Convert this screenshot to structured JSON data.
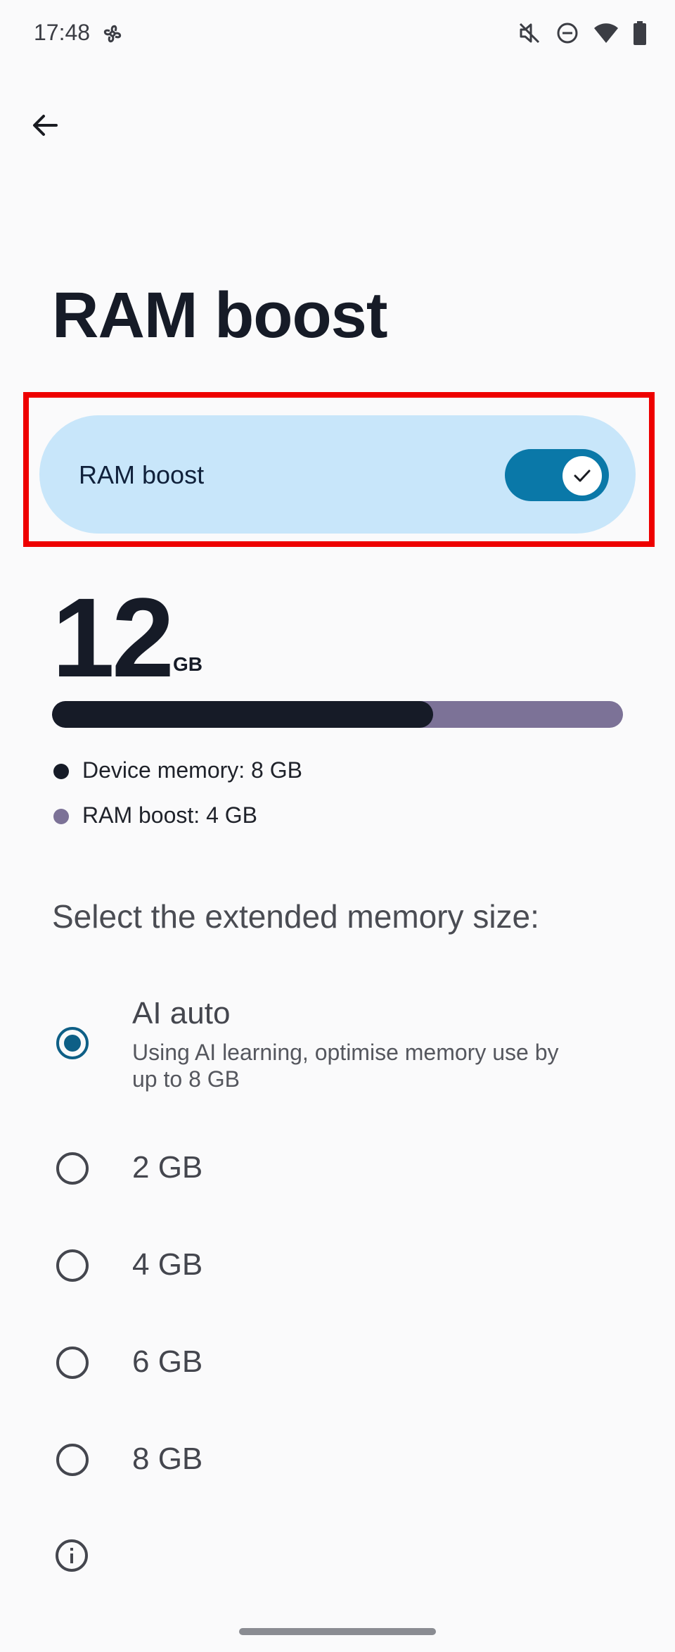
{
  "status_bar": {
    "time": "17:48",
    "icons": [
      "fan-icon",
      "mute-icon",
      "do-not-disturb-icon",
      "wifi-icon",
      "battery-icon"
    ]
  },
  "app_bar": {
    "back_icon": "back-arrow-icon"
  },
  "page": {
    "title": "RAM boost"
  },
  "boost_toggle": {
    "label": "RAM boost",
    "state": "on"
  },
  "memory": {
    "total_value": "12",
    "total_unit": "GB",
    "device_memory_gb": 8,
    "ram_boost_gb": 4,
    "device_fraction": 0.667,
    "legend": [
      {
        "label": "Device memory: 8 GB",
        "color": "#161b27"
      },
      {
        "label": "RAM boost: 4 GB",
        "color": "#7c7297"
      }
    ]
  },
  "selection": {
    "heading": "Select the extended memory size:",
    "options": [
      {
        "title": "AI auto",
        "description": "Using AI learning, optimise memory use by up to 8 GB",
        "selected": true
      },
      {
        "title": "2 GB",
        "selected": false
      },
      {
        "title": "4 GB",
        "selected": false
      },
      {
        "title": "6 GB",
        "selected": false
      },
      {
        "title": "8 GB",
        "selected": false
      }
    ]
  },
  "colors": {
    "accent": "#0a78a8",
    "card_bg": "#c8e6fa",
    "highlight": "#ee0000"
  }
}
